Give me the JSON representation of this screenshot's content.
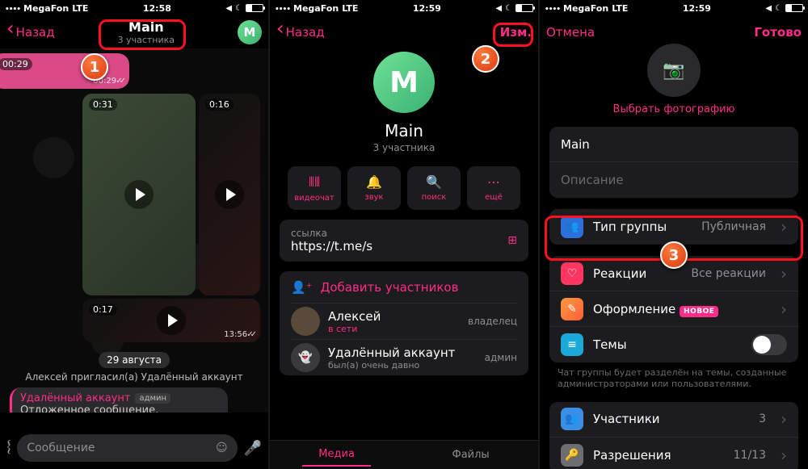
{
  "status": {
    "carrier": "MegaFon",
    "net": "LTE",
    "time1": "12:58",
    "time2": "12:59",
    "time3": "12:59"
  },
  "callouts": {
    "c1": "1",
    "c2": "2",
    "c3": "3"
  },
  "s1": {
    "nav_back": "Назад",
    "title": "Main",
    "sub": "3 участника",
    "avatar_letter": "M",
    "media1_dur": "00:29",
    "media1_time": "00:29",
    "media2_dur": "0:31",
    "media3_dur": "0:16",
    "media4_dur": "0:17",
    "media4_time": "13:56",
    "date_pill": "29 августа",
    "sys": "Алексей пригласил(а) Удалённый аккаунт",
    "reply_name": "Удалённый аккаунт",
    "reply_role": "админ",
    "reply_text": "Отложенное сообщение,",
    "input_placeholder": "Сообщение"
  },
  "s2": {
    "nav_back": "Назад",
    "nav_edit": "Изм.",
    "avatar_letter": "M",
    "name": "Main",
    "sub": "3 участника",
    "act_videochat": "видеочат",
    "act_sound": "звук",
    "act_search": "поиск",
    "act_more": "ещё",
    "link_label": "ссылка",
    "link_value": "https://t.me/s",
    "add_members": "Добавить участников",
    "m1_name": "Алексей",
    "m1_status": "в сети",
    "m1_role": "владелец",
    "m2_name": "Удалённый аккаунт",
    "m2_status": "был(а) очень давно",
    "m2_role": "админ",
    "tab_media": "Медиа",
    "tab_files": "Файлы"
  },
  "s3": {
    "cancel": "Отмена",
    "done": "Готово",
    "set_photo": "Выбрать фотографию",
    "name_val": "Main",
    "desc_placeholder": "Описание",
    "group_type": "Тип группы",
    "group_type_val": "Публичная",
    "reactions": "Реакции",
    "reactions_val": "Все реакции",
    "appearance": "Оформление",
    "appearance_badge": "НОВОЕ",
    "topics": "Темы",
    "topics_note": "Чат группы будет разделён на темы, созданные администраторами или пользователями.",
    "members": "Участники",
    "members_val": "3",
    "permissions": "Разрешения",
    "permissions_val": "11/13"
  }
}
